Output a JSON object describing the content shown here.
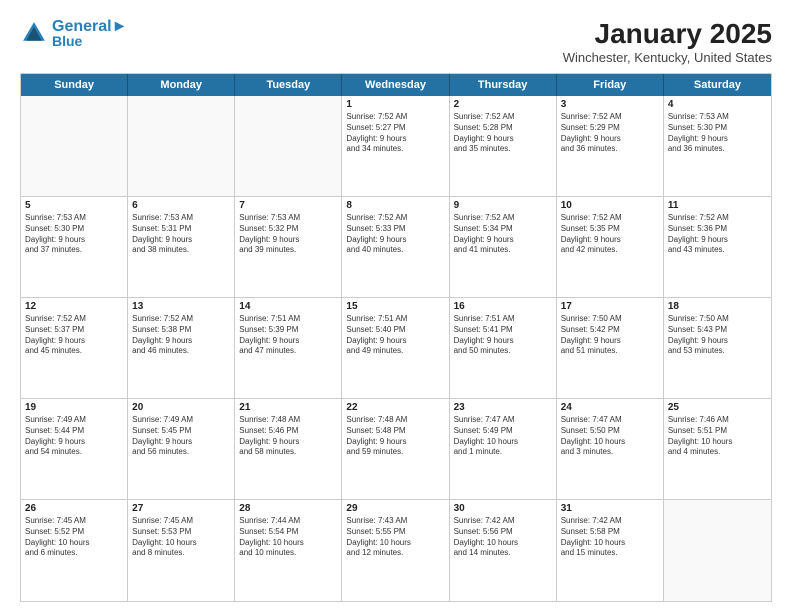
{
  "header": {
    "logo_line1": "General",
    "logo_line2": "Blue",
    "main_title": "January 2025",
    "subtitle": "Winchester, Kentucky, United States"
  },
  "weekdays": [
    "Sunday",
    "Monday",
    "Tuesday",
    "Wednesday",
    "Thursday",
    "Friday",
    "Saturday"
  ],
  "weeks": [
    [
      {
        "day": "",
        "info": ""
      },
      {
        "day": "",
        "info": ""
      },
      {
        "day": "",
        "info": ""
      },
      {
        "day": "1",
        "info": "Sunrise: 7:52 AM\nSunset: 5:27 PM\nDaylight: 9 hours\nand 34 minutes."
      },
      {
        "day": "2",
        "info": "Sunrise: 7:52 AM\nSunset: 5:28 PM\nDaylight: 9 hours\nand 35 minutes."
      },
      {
        "day": "3",
        "info": "Sunrise: 7:52 AM\nSunset: 5:29 PM\nDaylight: 9 hours\nand 36 minutes."
      },
      {
        "day": "4",
        "info": "Sunrise: 7:53 AM\nSunset: 5:30 PM\nDaylight: 9 hours\nand 36 minutes."
      }
    ],
    [
      {
        "day": "5",
        "info": "Sunrise: 7:53 AM\nSunset: 5:30 PM\nDaylight: 9 hours\nand 37 minutes."
      },
      {
        "day": "6",
        "info": "Sunrise: 7:53 AM\nSunset: 5:31 PM\nDaylight: 9 hours\nand 38 minutes."
      },
      {
        "day": "7",
        "info": "Sunrise: 7:53 AM\nSunset: 5:32 PM\nDaylight: 9 hours\nand 39 minutes."
      },
      {
        "day": "8",
        "info": "Sunrise: 7:52 AM\nSunset: 5:33 PM\nDaylight: 9 hours\nand 40 minutes."
      },
      {
        "day": "9",
        "info": "Sunrise: 7:52 AM\nSunset: 5:34 PM\nDaylight: 9 hours\nand 41 minutes."
      },
      {
        "day": "10",
        "info": "Sunrise: 7:52 AM\nSunset: 5:35 PM\nDaylight: 9 hours\nand 42 minutes."
      },
      {
        "day": "11",
        "info": "Sunrise: 7:52 AM\nSunset: 5:36 PM\nDaylight: 9 hours\nand 43 minutes."
      }
    ],
    [
      {
        "day": "12",
        "info": "Sunrise: 7:52 AM\nSunset: 5:37 PM\nDaylight: 9 hours\nand 45 minutes."
      },
      {
        "day": "13",
        "info": "Sunrise: 7:52 AM\nSunset: 5:38 PM\nDaylight: 9 hours\nand 46 minutes."
      },
      {
        "day": "14",
        "info": "Sunrise: 7:51 AM\nSunset: 5:39 PM\nDaylight: 9 hours\nand 47 minutes."
      },
      {
        "day": "15",
        "info": "Sunrise: 7:51 AM\nSunset: 5:40 PM\nDaylight: 9 hours\nand 49 minutes."
      },
      {
        "day": "16",
        "info": "Sunrise: 7:51 AM\nSunset: 5:41 PM\nDaylight: 9 hours\nand 50 minutes."
      },
      {
        "day": "17",
        "info": "Sunrise: 7:50 AM\nSunset: 5:42 PM\nDaylight: 9 hours\nand 51 minutes."
      },
      {
        "day": "18",
        "info": "Sunrise: 7:50 AM\nSunset: 5:43 PM\nDaylight: 9 hours\nand 53 minutes."
      }
    ],
    [
      {
        "day": "19",
        "info": "Sunrise: 7:49 AM\nSunset: 5:44 PM\nDaylight: 9 hours\nand 54 minutes."
      },
      {
        "day": "20",
        "info": "Sunrise: 7:49 AM\nSunset: 5:45 PM\nDaylight: 9 hours\nand 56 minutes."
      },
      {
        "day": "21",
        "info": "Sunrise: 7:48 AM\nSunset: 5:46 PM\nDaylight: 9 hours\nand 58 minutes."
      },
      {
        "day": "22",
        "info": "Sunrise: 7:48 AM\nSunset: 5:48 PM\nDaylight: 9 hours\nand 59 minutes."
      },
      {
        "day": "23",
        "info": "Sunrise: 7:47 AM\nSunset: 5:49 PM\nDaylight: 10 hours\nand 1 minute."
      },
      {
        "day": "24",
        "info": "Sunrise: 7:47 AM\nSunset: 5:50 PM\nDaylight: 10 hours\nand 3 minutes."
      },
      {
        "day": "25",
        "info": "Sunrise: 7:46 AM\nSunset: 5:51 PM\nDaylight: 10 hours\nand 4 minutes."
      }
    ],
    [
      {
        "day": "26",
        "info": "Sunrise: 7:45 AM\nSunset: 5:52 PM\nDaylight: 10 hours\nand 6 minutes."
      },
      {
        "day": "27",
        "info": "Sunrise: 7:45 AM\nSunset: 5:53 PM\nDaylight: 10 hours\nand 8 minutes."
      },
      {
        "day": "28",
        "info": "Sunrise: 7:44 AM\nSunset: 5:54 PM\nDaylight: 10 hours\nand 10 minutes."
      },
      {
        "day": "29",
        "info": "Sunrise: 7:43 AM\nSunset: 5:55 PM\nDaylight: 10 hours\nand 12 minutes."
      },
      {
        "day": "30",
        "info": "Sunrise: 7:42 AM\nSunset: 5:56 PM\nDaylight: 10 hours\nand 14 minutes."
      },
      {
        "day": "31",
        "info": "Sunrise: 7:42 AM\nSunset: 5:58 PM\nDaylight: 10 hours\nand 15 minutes."
      },
      {
        "day": "",
        "info": ""
      }
    ]
  ]
}
